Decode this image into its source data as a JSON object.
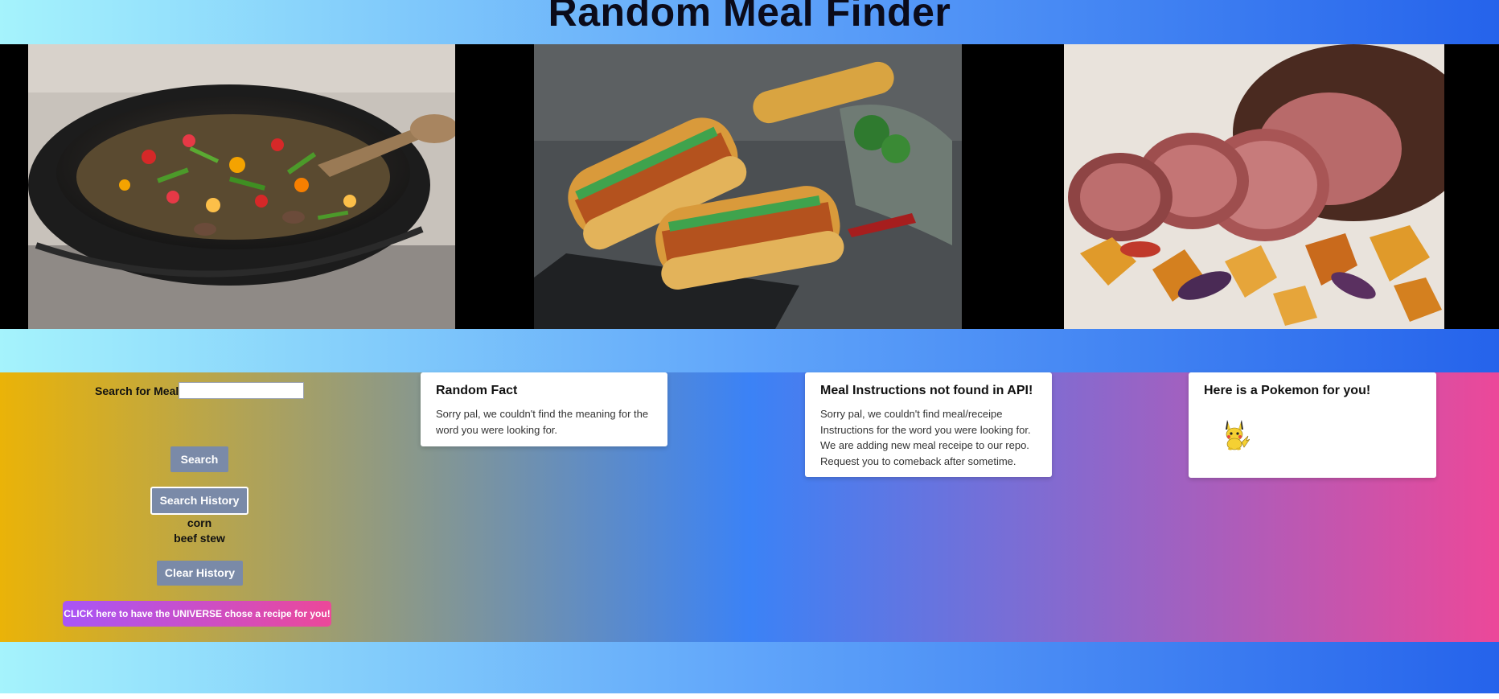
{
  "header": {
    "title": "Random Meal Finder"
  },
  "gallery": {
    "images": [
      {
        "name": "stir-fry-wok-photo"
      },
      {
        "name": "crispy-chicken-sandwich-photo"
      },
      {
        "name": "roast-beef-photo"
      }
    ]
  },
  "search": {
    "label": "Search for Meal:",
    "value": "",
    "placeholder": "",
    "search_button": "Search",
    "history_button": "Search History",
    "history": [
      "corn",
      "beef stew"
    ],
    "clear_button": "Clear History",
    "universe_button": "CLICK here to have the UNIVERSE chose a recipe for you!"
  },
  "cards": {
    "fact": {
      "title": "Random Fact",
      "text": "Sorry pal, we couldn't find the meaning for the word you were looking for."
    },
    "instructions": {
      "title": "Meal Instructions not found in API!",
      "text": "Sorry pal, we couldn't find meal/receipe Instructions for the word you were looking for. We are adding new meal receipe to our repo. Request you to comeback after sometime."
    },
    "pokemon": {
      "title": "Here is a Pokemon for you!",
      "sprite": "pikachu-icon"
    }
  },
  "colors": {
    "header_gradient": [
      "#a5f3fc",
      "#60a5fa",
      "#2563eb"
    ],
    "main_gradient": [
      "#eab308",
      "#3b82f6",
      "#ec4899"
    ],
    "button_gray": "#7a8aa8",
    "universe_gradient": [
      "#a855f7",
      "#ec4899"
    ]
  }
}
